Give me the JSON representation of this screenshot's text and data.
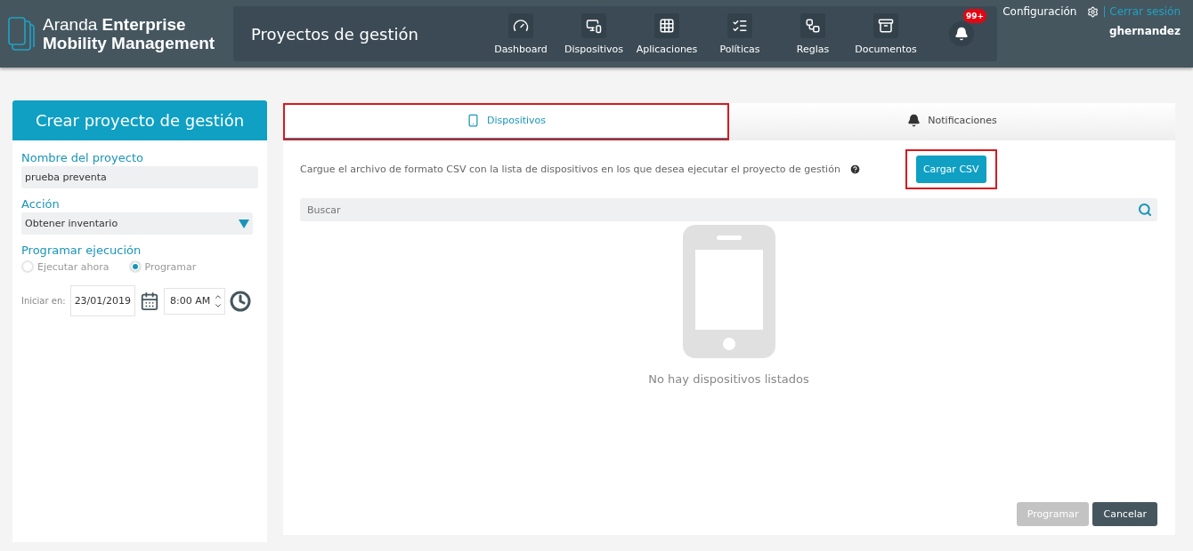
{
  "brand": {
    "light": "Aranda",
    "bold_line1": "Enterprise",
    "bold_line2": "Mobility Management"
  },
  "page_title": "Proyectos de gestión",
  "nav": [
    {
      "kind": "gauge",
      "label": "Dashboard"
    },
    {
      "kind": "devices",
      "label": "Dispositivos"
    },
    {
      "kind": "grid",
      "label": "Aplicaciones"
    },
    {
      "kind": "checklist",
      "label": "Políticas"
    },
    {
      "kind": "rules",
      "label": "Reglas"
    },
    {
      "kind": "cabinet",
      "label": "Documentos"
    }
  ],
  "notifications": {
    "badge": "99+"
  },
  "user": {
    "settings": "Configuración",
    "logout": "| Cerrar sesión",
    "name": "ghernandez"
  },
  "form": {
    "title": "Crear proyecto de gestión",
    "name_label": "Nombre del proyecto",
    "name_value": "prueba preventa",
    "action_label": "Acción",
    "action_value": "Obtener inventario",
    "schedule_label": "Programar ejecución",
    "radios": [
      {
        "label": "Ejecutar ahora",
        "selected": false
      },
      {
        "label": "Programar",
        "selected": true
      }
    ],
    "start_label": "Iniciar en:",
    "date": "23/01/2019",
    "time": "8:00 AM"
  },
  "tabs": [
    {
      "kind": "phone",
      "label": "Dispositivos",
      "selected": true,
      "highlighted": true
    },
    {
      "kind": "bell",
      "label": "Notificaciones",
      "selected": false,
      "highlighted": false
    }
  ],
  "instructions": "Cargue el archivo de formato CSV con la lista de dispositivos en los que desea ejecutar el proyecto de gestión",
  "upload_button": {
    "label": "Cargar CSV",
    "highlighted": true
  },
  "search": {
    "placeholder": "Buscar"
  },
  "empty_message": "No hay dispositivos listados",
  "buttons": [
    {
      "label": "Programar",
      "disabled": true
    },
    {
      "label": "Cancelar",
      "disabled": false
    }
  ]
}
